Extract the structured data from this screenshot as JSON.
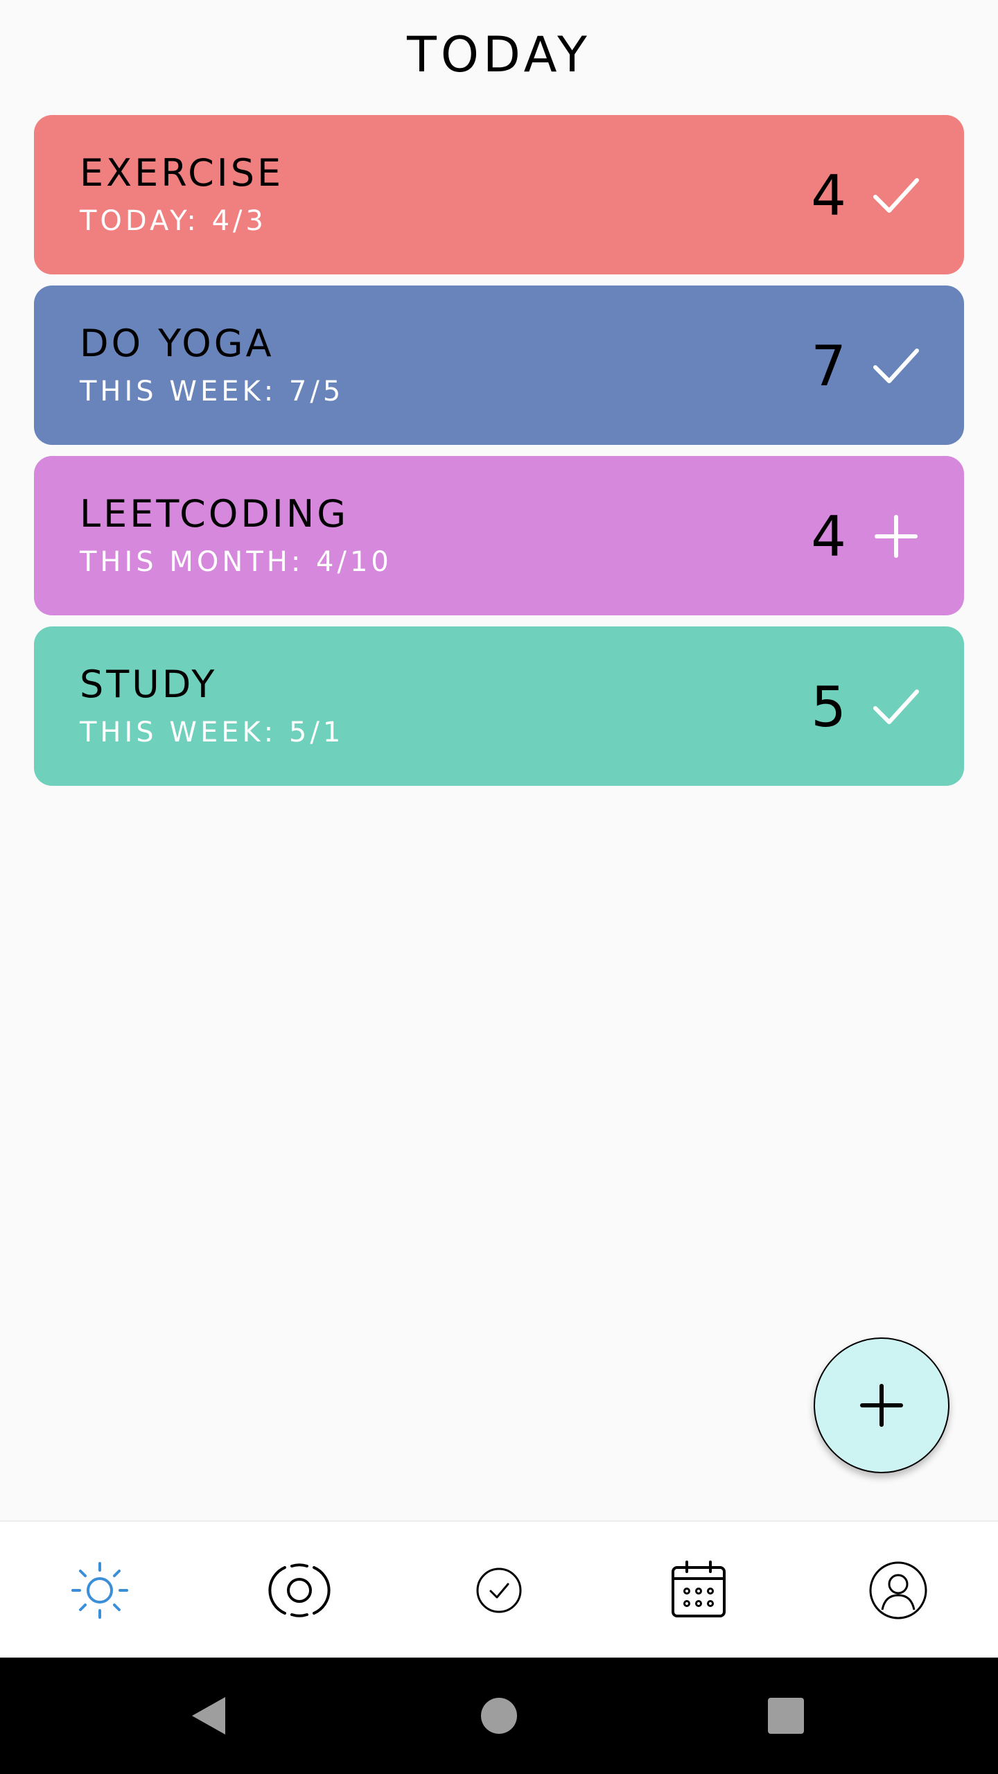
{
  "header": {
    "title": "TODAY"
  },
  "habits": [
    {
      "name": "EXERCISE",
      "progress": "TODAY: 4/3",
      "count": "4",
      "action_icon": "check-icon",
      "color": "#f08080"
    },
    {
      "name": "DO YOGA",
      "progress": "THIS WEEK: 7/5",
      "count": "7",
      "action_icon": "check-icon",
      "color": "#6984bb"
    },
    {
      "name": "LEETCODING",
      "progress": "THIS MONTH: 4/10",
      "count": "4",
      "action_icon": "plus-icon",
      "color": "#d588dc"
    },
    {
      "name": "STUDY",
      "progress": "THIS WEEK: 5/1",
      "count": "5",
      "action_icon": "check-icon",
      "color": "#6fd0bb"
    }
  ],
  "fab": {
    "icon": "plus-icon",
    "color": "#cdf3f3"
  },
  "bottom_nav": {
    "items": [
      {
        "icon": "sun-icon",
        "active": true
      },
      {
        "icon": "target-icon",
        "active": false
      },
      {
        "icon": "check-circle-icon",
        "active": false
      },
      {
        "icon": "calendar-icon",
        "active": false
      },
      {
        "icon": "profile-icon",
        "active": false
      }
    ],
    "active_color": "#3a8fd8"
  },
  "system_nav": {
    "icons": [
      "back-icon",
      "home-icon",
      "recents-icon"
    ]
  }
}
